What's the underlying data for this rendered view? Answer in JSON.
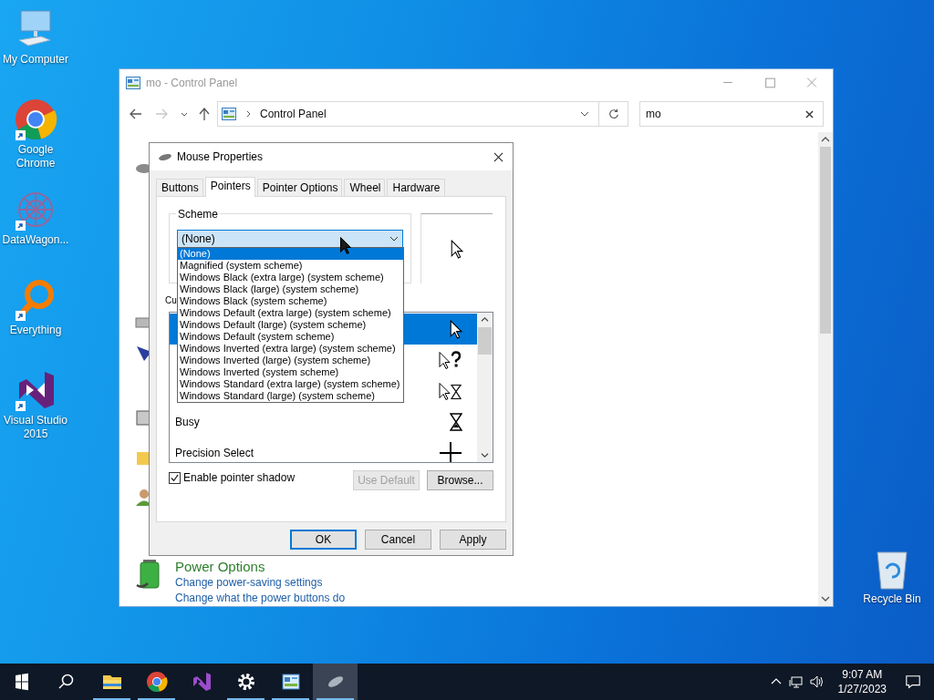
{
  "desktop_icons": [
    {
      "label": "My Computer",
      "kind": "computer",
      "shortcut": false
    },
    {
      "label": "Google Chrome",
      "kind": "chrome",
      "shortcut": true
    },
    {
      "label": "DataWagon...",
      "kind": "datawagon",
      "shortcut": true
    },
    {
      "label": "Everything",
      "kind": "everything",
      "shortcut": true
    },
    {
      "label": "Visual Studio 2015",
      "kind": "vs",
      "shortcut": true
    }
  ],
  "recycle_bin": {
    "label": "Recycle Bin"
  },
  "control_panel": {
    "title": "mo - Control Panel",
    "address": "Control Panel",
    "search": "mo",
    "hidden_items": [
      {
        "kind": "mouse"
      },
      {
        "kind": "printer"
      },
      {
        "kind": "flag"
      },
      {
        "kind": "device"
      },
      {
        "kind": "folder"
      },
      {
        "kind": "people"
      }
    ],
    "items": [
      {
        "title": "Power Options",
        "links": [
          "Change power-saving settings",
          "Change what the power buttons do"
        ]
      }
    ]
  },
  "mouse_dialog": {
    "title": "Mouse Properties",
    "tabs": [
      {
        "label": "Buttons",
        "selected": false
      },
      {
        "label": "Pointers",
        "selected": true
      },
      {
        "label": "Pointer Options",
        "selected": false
      },
      {
        "label": "Wheel",
        "selected": false
      },
      {
        "label": "Hardware",
        "selected": false
      }
    ],
    "scheme_label": "Scheme",
    "scheme_value": "(None)",
    "scheme_options": [
      {
        "label": "(None)",
        "selected": true
      },
      {
        "label": "Magnified (system scheme)",
        "selected": false
      },
      {
        "label": "Windows Black (extra large) (system scheme)",
        "selected": false
      },
      {
        "label": "Windows Black (large) (system scheme)",
        "selected": false
      },
      {
        "label": "Windows Black (system scheme)",
        "selected": false
      },
      {
        "label": "Windows Default (extra large) (system scheme)",
        "selected": false
      },
      {
        "label": "Windows Default (large) (system scheme)",
        "selected": false
      },
      {
        "label": "Windows Default (system scheme)",
        "selected": false
      },
      {
        "label": "Windows Inverted (extra large) (system scheme)",
        "selected": false
      },
      {
        "label": "Windows Inverted (large) (system scheme)",
        "selected": false
      },
      {
        "label": "Windows Inverted (system scheme)",
        "selected": false
      },
      {
        "label": "Windows Standard (extra large) (system scheme)",
        "selected": false
      },
      {
        "label": "Windows Standard (large) (system scheme)",
        "selected": false
      }
    ],
    "customize_label": "Cu",
    "pointers": [
      {
        "kind": "normal",
        "selected": true
      },
      {
        "kind": "help",
        "selected": false
      },
      {
        "kind": "working",
        "selected": false
      },
      {
        "name": "Busy",
        "kind": "busy",
        "selected": false
      },
      {
        "name": "Precision Select",
        "kind": "precision",
        "selected": false
      }
    ],
    "pointer_shadow": {
      "label": "Enable pointer shadow",
      "checked": true
    },
    "buttons": [
      {
        "label": "Use Default",
        "disabled": true
      },
      {
        "label": "Browse...",
        "disabled": false
      }
    ],
    "footer_buttons": [
      {
        "label": "OK",
        "default": true
      },
      {
        "label": "Cancel",
        "default": false
      },
      {
        "label": "Apply",
        "default": false
      }
    ]
  },
  "taskbar": {
    "apps": [
      {
        "kind": "explorer",
        "running": true,
        "active": false
      },
      {
        "kind": "chrome",
        "running": true,
        "active": false
      },
      {
        "kind": "vs",
        "running": false,
        "active": false
      },
      {
        "kind": "settings",
        "running": true,
        "active": false
      },
      {
        "kind": "controlpanel",
        "running": true,
        "active": false
      },
      {
        "kind": "mouse",
        "running": true,
        "active": true
      }
    ],
    "time": "9:07 AM",
    "date": "1/27/2023"
  }
}
